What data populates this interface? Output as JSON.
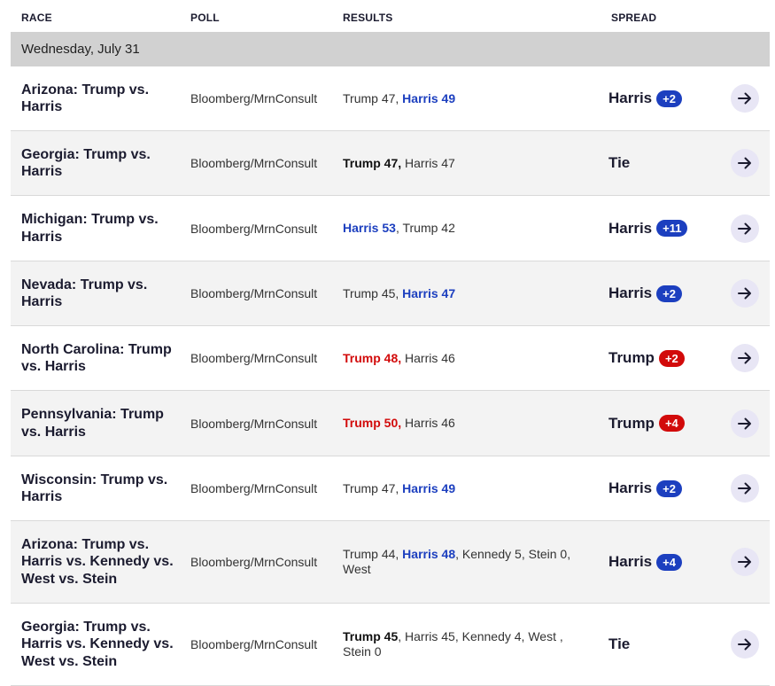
{
  "headers": {
    "race": "RACE",
    "poll": "POLL",
    "results": "RESULTS",
    "spread": "SPREAD"
  },
  "date_label": "Wednesday, July 31",
  "rows": [
    {
      "race": "Arizona: Trump vs. Harris",
      "poll": "Bloomberg/MrnConsult",
      "results": [
        {
          "text": "Trump 47",
          "style": "plain"
        },
        {
          "text": ", ",
          "style": "plain"
        },
        {
          "text": "Harris 49",
          "style": "blue"
        }
      ],
      "spread": {
        "leader": "Harris",
        "margin": "+2",
        "color": "blue"
      }
    },
    {
      "race": "Georgia: Trump vs. Harris",
      "poll": "Bloomberg/MrnConsult",
      "results": [
        {
          "text": "Trump 47,",
          "style": "bold"
        },
        {
          "text": " Harris 47",
          "style": "plain"
        }
      ],
      "spread": {
        "leader": "Tie",
        "margin": "",
        "color": "none"
      }
    },
    {
      "race": "Michigan: Trump vs. Harris",
      "poll": "Bloomberg/MrnConsult",
      "results": [
        {
          "text": "Harris 53",
          "style": "blue"
        },
        {
          "text": ", Trump 42",
          "style": "plain"
        }
      ],
      "spread": {
        "leader": "Harris",
        "margin": "+11",
        "color": "blue"
      }
    },
    {
      "race": "Nevada: Trump vs. Harris",
      "poll": "Bloomberg/MrnConsult",
      "results": [
        {
          "text": "Trump 45, ",
          "style": "plain"
        },
        {
          "text": "Harris 47",
          "style": "blue"
        }
      ],
      "spread": {
        "leader": "Harris",
        "margin": "+2",
        "color": "blue"
      }
    },
    {
      "race": "North Carolina: Trump vs. Harris",
      "poll": "Bloomberg/MrnConsult",
      "results": [
        {
          "text": "Trump 48,",
          "style": "red"
        },
        {
          "text": " Harris 46",
          "style": "plain"
        }
      ],
      "spread": {
        "leader": "Trump",
        "margin": "+2",
        "color": "red"
      }
    },
    {
      "race": "Pennsylvania: Trump vs. Harris",
      "poll": "Bloomberg/MrnConsult",
      "results": [
        {
          "text": "Trump 50,",
          "style": "red"
        },
        {
          "text": " Harris 46",
          "style": "plain"
        }
      ],
      "spread": {
        "leader": "Trump",
        "margin": "+4",
        "color": "red"
      }
    },
    {
      "race": "Wisconsin: Trump vs. Harris",
      "poll": "Bloomberg/MrnConsult",
      "results": [
        {
          "text": "Trump 47, ",
          "style": "plain"
        },
        {
          "text": "Harris 49",
          "style": "blue"
        }
      ],
      "spread": {
        "leader": "Harris",
        "margin": "+2",
        "color": "blue"
      }
    },
    {
      "race": "Arizona: Trump vs. Harris vs. Kennedy vs. West vs. Stein",
      "poll": "Bloomberg/MrnConsult",
      "results": [
        {
          "text": "Trump 44, ",
          "style": "plain"
        },
        {
          "text": "Harris 48",
          "style": "blue"
        },
        {
          "text": ", Kennedy 5, Stein 0, West",
          "style": "plain"
        }
      ],
      "spread": {
        "leader": "Harris",
        "margin": "+4",
        "color": "blue"
      }
    },
    {
      "race": "Georgia: Trump vs. Harris vs. Kennedy vs. West vs. Stein",
      "poll": "Bloomberg/MrnConsult",
      "results": [
        {
          "text": "Trump 45",
          "style": "bold"
        },
        {
          "text": ", Harris 45, Kennedy 4, West , Stein 0",
          "style": "plain"
        }
      ],
      "spread": {
        "leader": "Tie",
        "margin": "",
        "color": "none"
      }
    }
  ],
  "colors": {
    "democrat": "#1c3fbf",
    "republican": "#d20a0a",
    "stripe": "#f3f3f3",
    "date_bar": "#d1d1d1"
  },
  "icons": {
    "row_action": "arrow-right-icon"
  }
}
